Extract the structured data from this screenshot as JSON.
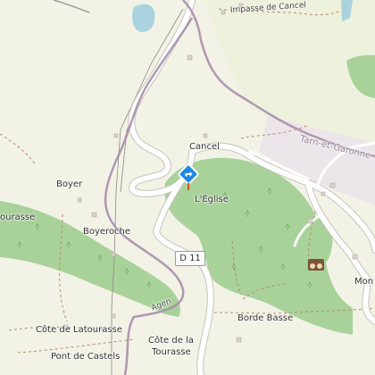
{
  "map": {
    "labels": {
      "impasse": "Impasse de Cancel",
      "region": "Tarn-et-Garonne",
      "cancel": "Cancel",
      "boyer": "Boyer",
      "eglise": "L'Église",
      "tourasse": "ourasse",
      "boyeroche": "Boyeroche",
      "agen": "Agen",
      "borde_basse": "Borde Basse",
      "cote_latourasse": "Côte de Latourasse",
      "cote_tourasse_1": "Côte de la",
      "cote_tourasse_2": "Tourasse",
      "pont_castels": "Pont de Castels",
      "mon": "Mon"
    },
    "road_shield": "D 11",
    "colors": {
      "background": "#f2efe9",
      "forest": "#a8d29a",
      "road": "#ffffff",
      "boundary": "#a28aa6",
      "water": "#aad3df",
      "marker": "#1e88e5"
    },
    "icons": {
      "marker": "directions-marker-icon",
      "viewpoint": "binoculars-icon"
    }
  }
}
